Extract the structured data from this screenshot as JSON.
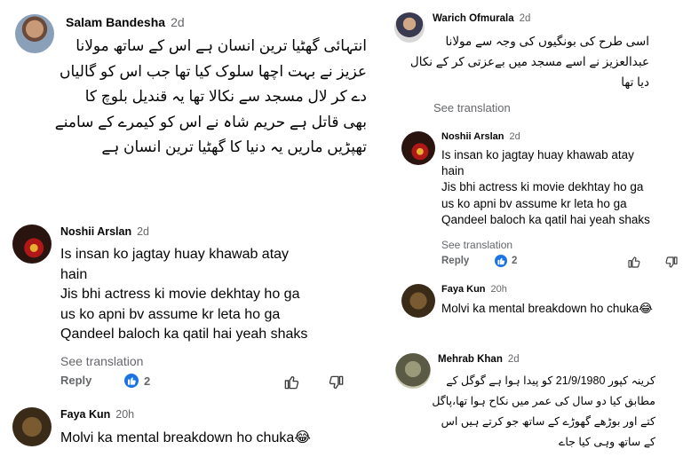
{
  "left_comments": [
    {
      "author": "Salam Bandesha",
      "age": "2d",
      "lines": [
        "انتہائی گھٹیا ترین انسان ہے اس کے ساتھ مولانا",
        "عزیز نے بہت اچھا سلوک کیا تھا جب اس کو گالیاں",
        "دے کر لال مسجد سے نکالا تھا یہ قندیل بلوچ کا",
        "بھی قاتل ہے حریم شاہ نے اس کو کیمرے کے سامنے",
        "تھپڑیں ماریں یہ دنیا کا گھٹیا ترین انسان ہے"
      ]
    },
    {
      "author": "Noshii Arslan",
      "age": "2d",
      "lines": [
        "Is insan ko jagtay huay khawab atay",
        "hain",
        "Jis bhi actress ki movie dekhtay ho ga",
        "us ko apni bv assume kr leta ho ga",
        "Qandeel baloch ka qatil hai yeah shaks"
      ],
      "see_translation": "See translation",
      "reply": "Reply",
      "reaction_count": "2"
    },
    {
      "author": "Faya Kun",
      "age": "20h",
      "lines": [
        "Molvi ka mental breakdown ho chuka😂"
      ]
    }
  ],
  "right_comments": [
    {
      "author": "Warich Ofmurala",
      "age": "2d",
      "lines": [
        "اسی طرح کی بونگیوں کی وجہ سے مولانا",
        "عبدالعزیز نے اسے مسجد میں بےعزتی کر کے نکال",
        "دیا تھا"
      ],
      "see_translation": "See translation"
    },
    {
      "author": "Noshii Arslan",
      "age": "2d",
      "lines": [
        "Is insan ko jagtay huay khawab atay",
        "hain",
        "Jis bhi actress ki movie dekhtay ho ga",
        "us ko apni bv assume kr leta ho ga",
        "Qandeel baloch ka qatil hai yeah shaks"
      ],
      "see_translation": "See translation",
      "reply": "Reply",
      "reaction_count": "2"
    },
    {
      "author": "Faya Kun",
      "age": "20h",
      "lines": [
        "Molvi ka mental breakdown ho chuka😂"
      ]
    },
    {
      "author": "Mehrab Khan",
      "age": "2d",
      "lines": [
        "کرینہ کپور 21/9/1980 کو پیدا ہوا ہے گوگل کے",
        "مطابق کیا دو سال کی عمر میں نکاح ہوا تھا،پاگل",
        "کتے اور بوڑھے گھوڑے کے ساتھ جو کرتے ہیں اس",
        "کے ساتھ وہی کیا جاے"
      ]
    }
  ],
  "icons": {
    "like": "thumbs-up-icon",
    "dislike": "thumbs-down-icon",
    "reaction": "like-reaction-icon"
  },
  "colors": {
    "secondary_text": "#65676b",
    "like_blue": "#1b74e4"
  }
}
